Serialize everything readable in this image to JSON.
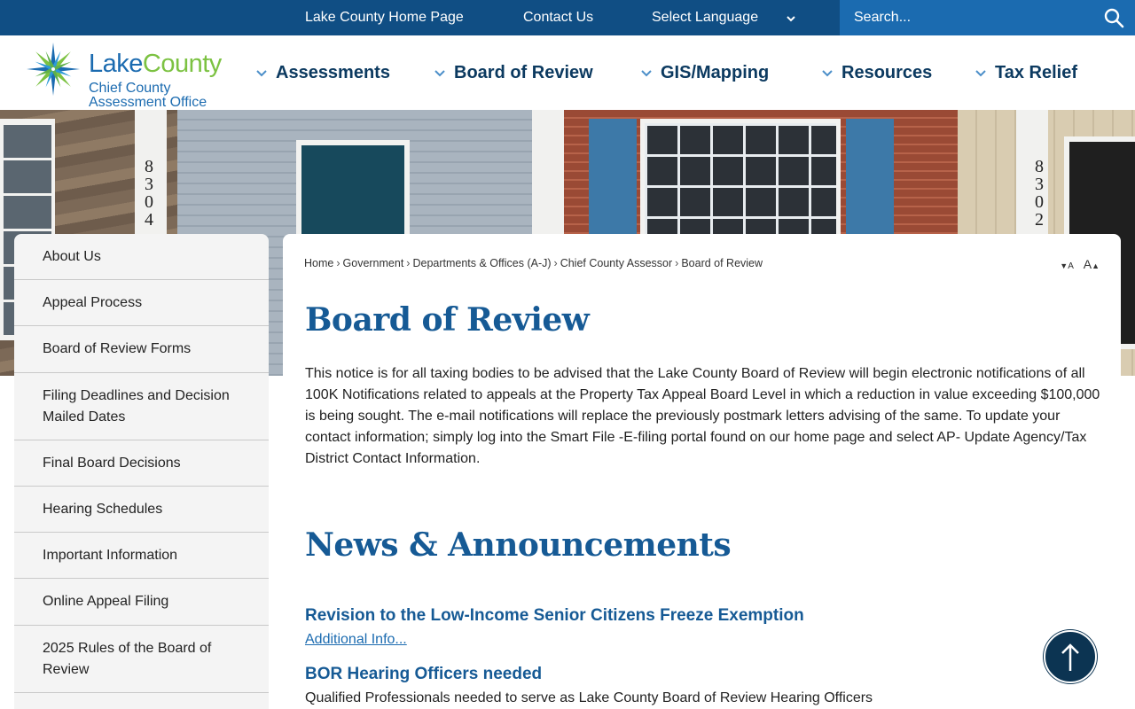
{
  "topbar": {
    "home_link": "Lake County Home Page",
    "contact_link": "Contact Us",
    "language_label": "Select Language",
    "search_placeholder": "Search..."
  },
  "logo": {
    "name_part1": "Lake",
    "name_part2": "County",
    "subtitle_line1": "Chief County",
    "subtitle_line2": "Assessment Office"
  },
  "nav": {
    "items": [
      {
        "label": "Assessments"
      },
      {
        "label": "Board of Review"
      },
      {
        "label": "GIS/Mapping"
      },
      {
        "label": "Resources"
      },
      {
        "label": "Tax Relief"
      }
    ]
  },
  "hero": {
    "house_number_1": "8304",
    "house_number_2": "8302"
  },
  "sidebar": {
    "items": [
      {
        "label": "About Us"
      },
      {
        "label": "Appeal Process"
      },
      {
        "label": "Board of Review Forms"
      },
      {
        "label": "Filing Deadlines and Decision Mailed Dates"
      },
      {
        "label": "Final Board Decisions"
      },
      {
        "label": "Hearing Schedules"
      },
      {
        "label": "Important Information"
      },
      {
        "label": "Online Appeal Filing"
      },
      {
        "label": "2025 Rules of the Board of Review"
      },
      {
        "label": ""
      }
    ]
  },
  "breadcrumb": {
    "items": [
      "Home",
      "Government",
      "Departments & Offices (A-J)",
      "Chief County Assessor",
      "Board of Review"
    ],
    "separator": "›"
  },
  "font_controls": {
    "decrease": "A",
    "increase": "A"
  },
  "main": {
    "title": "Board of Review",
    "notice": "This notice is for all taxing bodies to be advised that the Lake County Board of Review will begin electronic notifications of all 100K Notifications related to appeals at the Property Tax Appeal Board Level in which a reduction in value exceeding $100,000 is being sought. The e-mail notifications will replace the previously postmark letters advising of the same. To update your contact information; simply log into the Smart File -E-filing portal found on our home page and select AP- Update Agency/Tax District Contact Information.",
    "news_title": "News & Announcements",
    "news": [
      {
        "title": "Revision to the Low-Income Senior Citizens Freeze Exemption",
        "link": "Additional Info..."
      },
      {
        "title": "BOR Hearing Officers needed",
        "description": "Qualified Professionals needed to serve as Lake County Board of Review Hearing Officers"
      }
    ]
  },
  "colors": {
    "topbar": "#104e84",
    "search_bg": "#1b6bb0",
    "heading_blue": "#165a95",
    "nav_text": "#0c3a60",
    "logo_green": "#7cc242",
    "back_to_top": "#0c3452"
  },
  "icons": {
    "search": "search-icon",
    "chevron": "chevron-down-icon",
    "back_to_top": "arrow-up-icon"
  }
}
